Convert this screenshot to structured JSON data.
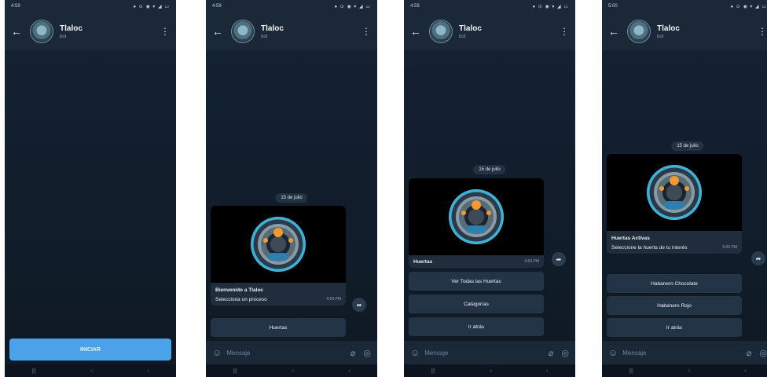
{
  "phones": [
    {
      "status_time": "4:59",
      "status_icons": "● ⊙ ◉ ▾ ◢ ▭",
      "chat_title": "Tlaloc",
      "chat_sub": "bot",
      "start_button": "INICIAR",
      "nav": [
        "|||",
        "○",
        "‹"
      ]
    },
    {
      "status_time": "4:59",
      "status_icons": "● ⊙ ◉ ▾ ◢ ▭",
      "chat_title": "Tlaloc",
      "chat_sub": "bot",
      "date": "15 de julio",
      "message_title": "Bienvenido a Tlaloc",
      "message_body": "Selecciona un proceso",
      "message_time": "4:59 PM",
      "buttons": [
        "Huertas"
      ],
      "compose_placeholder": "Mensaje",
      "nav": [
        "|||",
        "○",
        "‹"
      ]
    },
    {
      "status_time": "4:59",
      "status_icons": "● ⊙ ◉ ▾ ◢ ▭",
      "chat_title": "Tlaloc",
      "chat_sub": "bot",
      "date": "15 de julio",
      "message_title": "Huertas",
      "message_time": "4:59 PM",
      "buttons": [
        "Ver Todas las Huertas",
        "Categorías",
        "Ir atrás"
      ],
      "compose_placeholder": "Mensaje",
      "nav": [
        "|||",
        "○",
        "‹"
      ]
    },
    {
      "status_time": "5:00",
      "status_icons": "● ⊙ ◉ ▾ ◢ ▭",
      "chat_title": "Tlaloc",
      "chat_sub": "bot",
      "date": "15 de julio",
      "message_title": "Huertas Activas",
      "message_body": "Seleccione la huerta de tu interés",
      "message_time": "5:00 PM",
      "buttons": [
        "Habanero Chocolate",
        "Habanero Rojo",
        "Ir atrás"
      ],
      "compose_placeholder": "Mensaje",
      "nav": [
        "|||",
        "○",
        "‹"
      ]
    }
  ],
  "icons": {
    "back": "←",
    "menu": "⋮",
    "share": "➦",
    "emoji": "☺",
    "attach": "⌀",
    "camera": "◎"
  }
}
